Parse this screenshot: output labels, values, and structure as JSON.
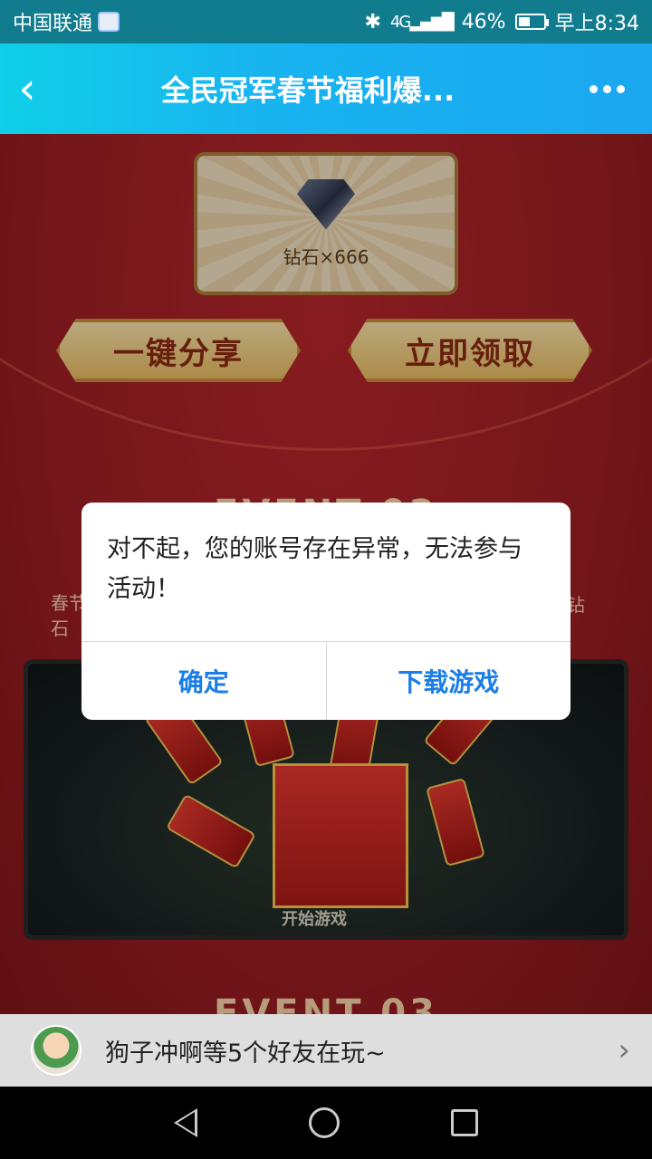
{
  "status_bar": {
    "carrier": "中国联通",
    "bluetooth": "✱",
    "network": "4G",
    "battery_percent": "46%",
    "time": "早上8:34",
    "battery_level": 0.46
  },
  "header": {
    "back_icon": "chevron-left-icon",
    "title": "全民冠军春节福利爆...",
    "more_icon": "more-dots-icon"
  },
  "content": {
    "prize": {
      "label": "钻石×666",
      "icon": "diamond-icon"
    },
    "share_button": "一键分享",
    "claim_button": "立即领取",
    "event_02_heading": "EVENT 02",
    "event_02_desc_left": "春节\n石",
    "event_02_desc_right": "钻",
    "game_preview_label": "开始游戏",
    "event_03_heading": "EVENT 03"
  },
  "dialog": {
    "message": "对不起，您的账号存在异常，无法参与活动！",
    "confirm_button": "确定",
    "download_button": "下载游戏",
    "accent": "#1a7ee6"
  },
  "friends_bar": {
    "text": "狗子冲啊等5个好友在玩~",
    "chevron": "›"
  },
  "nav_bar": {
    "icons": [
      "back-triangle-icon",
      "home-circle-icon",
      "recent-square-icon"
    ]
  },
  "colors": {
    "header_gradient_start": "#10cfe8",
    "header_gradient_end": "#1aa7f0",
    "page_background": "#9c1e23",
    "button_gold": "#e6b960"
  }
}
